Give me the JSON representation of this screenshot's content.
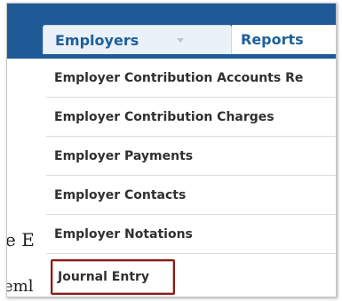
{
  "nav": {
    "tabs": [
      {
        "label": "Employers"
      },
      {
        "label": "Reports"
      }
    ]
  },
  "menu": {
    "items": [
      {
        "label": "Employer Contribution Accounts Re"
      },
      {
        "label": "Employer Contribution Charges"
      },
      {
        "label": "Employer Payments"
      },
      {
        "label": "Employer Contacts"
      },
      {
        "label": "Employer Notations"
      },
      {
        "label": "Journal Entry"
      }
    ]
  },
  "background": {
    "fragment_1": "e E",
    "fragment_2": "eml"
  },
  "colors": {
    "nav_bar": "#1e5a96",
    "active_tab": "#eaf1f8",
    "tab_text": "#1f5f9c",
    "highlight_border": "#8b1a1a"
  }
}
